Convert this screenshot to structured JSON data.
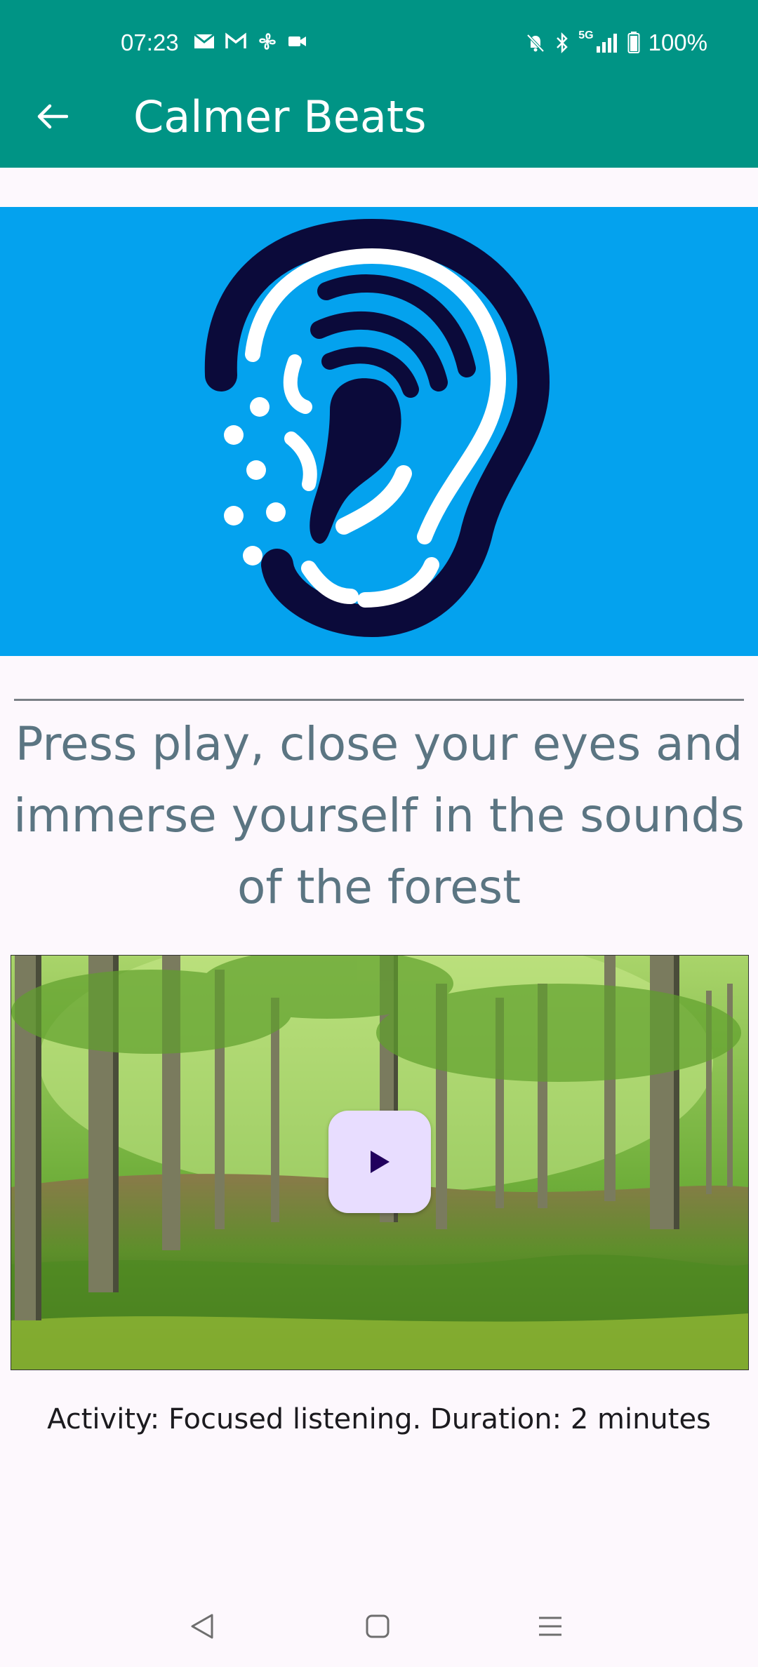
{
  "status_bar": {
    "time": "07:23",
    "battery": "100%",
    "signal_label": "5G",
    "icons_left": [
      "gmail-envelope-icon",
      "gmail-m-icon",
      "fan-icon",
      "video-camera-icon"
    ],
    "icons_right": [
      "mute-bell-icon",
      "bluetooth-icon",
      "signal-icon",
      "battery-icon"
    ]
  },
  "toolbar": {
    "title": "Calmer Beats",
    "back_icon": "arrow-left-icon"
  },
  "hero": {
    "icon": "ear-sound-icon",
    "background_color": "#04a2ee"
  },
  "content": {
    "headline": "Press play, close your eyes and immerse yourself in the sounds of the forest",
    "caption": "Activity: Focused listening. Duration: 2 minutes"
  },
  "video": {
    "play_icon": "play-icon",
    "scene": "forest-thumbnail"
  },
  "nav_bar": {
    "icons": [
      "back-triangle-icon",
      "home-square-icon",
      "recents-menu-icon"
    ]
  },
  "colors": {
    "app_bar": "#009485",
    "headline_text": "#5b7582",
    "play_button_bg": "#e8ddff",
    "play_icon": "#21005d"
  }
}
